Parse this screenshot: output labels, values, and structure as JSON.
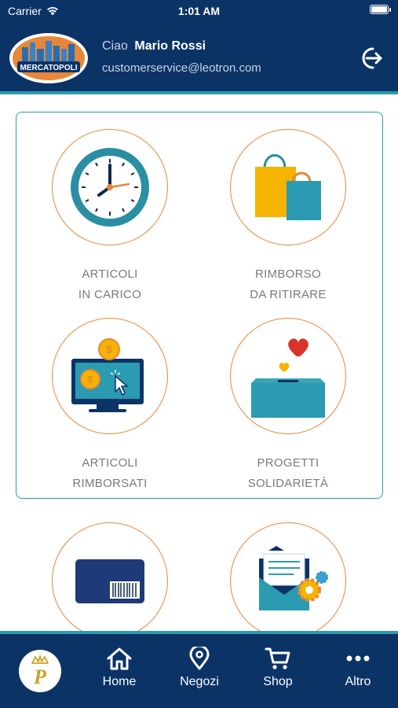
{
  "status_bar": {
    "carrier": "Carrier",
    "time": "1:01 AM"
  },
  "header": {
    "logo_text": "MERCATOPOLI",
    "greeting": "Ciao",
    "user_name": "Mario Rossi",
    "email": "customerservice@leotron.com"
  },
  "tiles": [
    {
      "line1": "ARTICOLI",
      "line2": "IN CARICO"
    },
    {
      "line1": "RIMBORSO",
      "line2": "DA RITIRARE"
    },
    {
      "line1": "ARTICOLI",
      "line2": "RIMBORSATI"
    },
    {
      "line1": "PROGETTI",
      "line2": "SOLIDARIETÀ"
    }
  ],
  "tab_bar": {
    "brand_letter": "P",
    "items": [
      {
        "label": "Home",
        "icon": "home-icon"
      },
      {
        "label": "Negozi",
        "icon": "map-pin-icon"
      },
      {
        "label": "Shop",
        "icon": "cart-icon"
      },
      {
        "label": "Altro",
        "icon": "more-icon"
      }
    ]
  },
  "colors": {
    "navy": "#0b3366",
    "teal": "#2a9bb0",
    "orange": "#e8873a",
    "label_gray": "#7a7a7a"
  }
}
